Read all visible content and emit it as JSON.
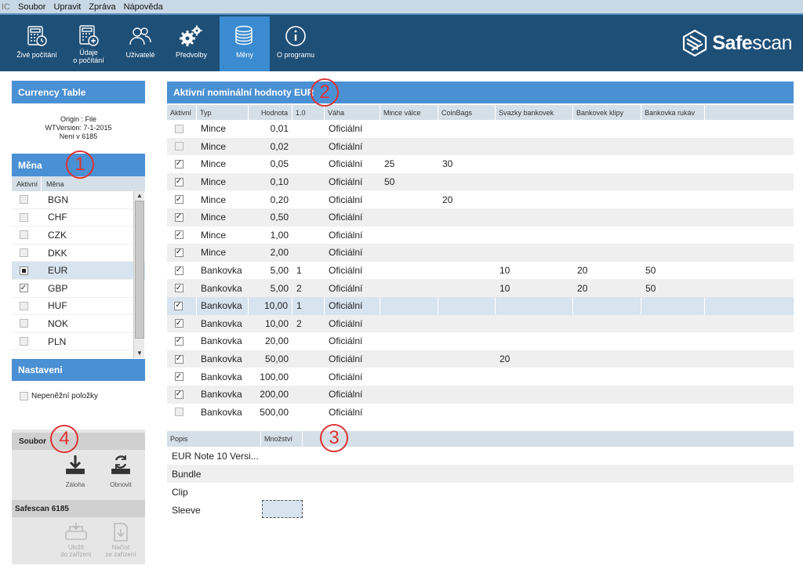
{
  "menubar": {
    "app_fragment": "IC",
    "items": [
      "Soubor",
      "Upravit",
      "Zpráva",
      "Nápověda"
    ]
  },
  "toolbar": {
    "buttons": [
      {
        "label": "Živé počítání",
        "icon": "calculator-clock-icon"
      },
      {
        "label": "Údaje\no počítání",
        "icon": "calculator-plus-icon"
      },
      {
        "label": "Uživatelé",
        "icon": "users-icon"
      },
      {
        "label": "Předvolby",
        "icon": "gears-icon"
      },
      {
        "label": "Měny",
        "icon": "coins-icon",
        "active": true
      },
      {
        "label": "O programu",
        "icon": "info-icon"
      }
    ],
    "logo": {
      "safe": "Safe",
      "scan": "scan"
    }
  },
  "left": {
    "currency_table_title": "Currency Table",
    "origin_lines": [
      "Origin : File",
      "WTVersion: 7-1-2015",
      "Není v 6185"
    ],
    "mena_title": "Měna",
    "mena_columns": [
      "Aktivní",
      "Měna"
    ],
    "currencies": [
      {
        "code": "BGN",
        "state": "off"
      },
      {
        "code": "CHF",
        "state": "off"
      },
      {
        "code": "CZK",
        "state": "off"
      },
      {
        "code": "DKK",
        "state": "off"
      },
      {
        "code": "EUR",
        "state": "partial",
        "selected": true
      },
      {
        "code": "GBP",
        "state": "on"
      },
      {
        "code": "HUF",
        "state": "off"
      },
      {
        "code": "NOK",
        "state": "off"
      },
      {
        "code": "PLN",
        "state": "off"
      }
    ],
    "nastaveni_title": "Nastaveni",
    "non_cash_label": "Nepeněžní položky",
    "soubor_title": "Soubor",
    "zaloha_label": "Záloha",
    "obnovit_label": "Obnovit",
    "device_title": "Safescan 6185",
    "ulozit_label": "Uložit\ndo zařízení",
    "nacist_label": "Načíst\nze zařízení"
  },
  "right": {
    "title": "Aktivní nominální hodnoty EUR",
    "columns": [
      "Aktivní",
      "Typ",
      "Hodnota",
      "1.0",
      "Váha",
      "Mince válce",
      "CoinBags",
      "Svazky bankovek",
      "Bankovek klipy",
      "Bankovka rukáv"
    ],
    "rows": [
      {
        "active": false,
        "type": "Mince",
        "value": "0,01",
        "v10": "",
        "weight": "Oficiální",
        "rolls": "",
        "bags": "",
        "bundles": "",
        "clips": "",
        "sleeves": ""
      },
      {
        "active": false,
        "type": "Mince",
        "value": "0,02",
        "v10": "",
        "weight": "Oficiální",
        "rolls": "",
        "bags": "",
        "bundles": "",
        "clips": "",
        "sleeves": ""
      },
      {
        "active": true,
        "type": "Mince",
        "value": "0,05",
        "v10": "",
        "weight": "Oficiální",
        "rolls": "25",
        "bags": "30",
        "bundles": "",
        "clips": "",
        "sleeves": ""
      },
      {
        "active": true,
        "type": "Mince",
        "value": "0,10",
        "v10": "",
        "weight": "Oficiální",
        "rolls": "50",
        "bags": "",
        "bundles": "",
        "clips": "",
        "sleeves": ""
      },
      {
        "active": true,
        "type": "Mince",
        "value": "0,20",
        "v10": "",
        "weight": "Oficiální",
        "rolls": "",
        "bags": "20",
        "bundles": "",
        "clips": "",
        "sleeves": ""
      },
      {
        "active": true,
        "type": "Mince",
        "value": "0,50",
        "v10": "",
        "weight": "Oficiální",
        "rolls": "",
        "bags": "",
        "bundles": "",
        "clips": "",
        "sleeves": ""
      },
      {
        "active": true,
        "type": "Mince",
        "value": "1,00",
        "v10": "",
        "weight": "Oficiální",
        "rolls": "",
        "bags": "",
        "bundles": "",
        "clips": "",
        "sleeves": ""
      },
      {
        "active": true,
        "type": "Mince",
        "value": "2,00",
        "v10": "",
        "weight": "Oficiální",
        "rolls": "",
        "bags": "",
        "bundles": "",
        "clips": "",
        "sleeves": ""
      },
      {
        "active": true,
        "type": "Bankovka",
        "value": "5,00",
        "v10": "1",
        "weight": "Oficiální",
        "rolls": "",
        "bags": "",
        "bundles": "10",
        "clips": "20",
        "sleeves": "50"
      },
      {
        "active": true,
        "type": "Bankovka",
        "value": "5,00",
        "v10": "2",
        "weight": "Oficiální",
        "rolls": "",
        "bags": "",
        "bundles": "10",
        "clips": "20",
        "sleeves": "50"
      },
      {
        "active": true,
        "type": "Bankovka",
        "value": "10,00",
        "v10": "1",
        "weight": "Oficiální",
        "rolls": "",
        "bags": "",
        "bundles": "",
        "clips": "",
        "sleeves": "",
        "selected": true
      },
      {
        "active": true,
        "type": "Bankovka",
        "value": "10,00",
        "v10": "2",
        "weight": "Oficiální",
        "rolls": "",
        "bags": "",
        "bundles": "",
        "clips": "",
        "sleeves": ""
      },
      {
        "active": true,
        "type": "Bankovka",
        "value": "20,00",
        "v10": "",
        "weight": "Oficiální",
        "rolls": "",
        "bags": "",
        "bundles": "",
        "clips": "",
        "sleeves": ""
      },
      {
        "active": true,
        "type": "Bankovka",
        "value": "50,00",
        "v10": "",
        "weight": "Oficiální",
        "rolls": "",
        "bags": "",
        "bundles": "20",
        "clips": "",
        "sleeves": ""
      },
      {
        "active": true,
        "type": "Bankovka",
        "value": "100,00",
        "v10": "",
        "weight": "Oficiální",
        "rolls": "",
        "bags": "",
        "bundles": "",
        "clips": "",
        "sleeves": ""
      },
      {
        "active": true,
        "type": "Bankovka",
        "value": "200,00",
        "v10": "",
        "weight": "Oficiální",
        "rolls": "",
        "bags": "",
        "bundles": "",
        "clips": "",
        "sleeves": ""
      },
      {
        "active": false,
        "type": "Bankovka",
        "value": "500,00",
        "v10": "",
        "weight": "Oficiální",
        "rolls": "",
        "bags": "",
        "bundles": "",
        "clips": "",
        "sleeves": ""
      }
    ],
    "popis_columns": [
      "Popis",
      "Množství"
    ],
    "popis_rows": [
      {
        "popis": "EUR Note 10 Versi...",
        "qty": ""
      },
      {
        "popis": "Bundle",
        "qty": ""
      },
      {
        "popis": "Clip",
        "qty": ""
      },
      {
        "popis": "Sleeve",
        "qty": ""
      }
    ]
  },
  "annotations": [
    "1",
    "2",
    "3",
    "4"
  ],
  "colors": {
    "header_blue": "#4a90d4",
    "toolbar": "#1e4f77",
    "active_tab": "#3b8bd0",
    "annotation_red": "#d33333"
  }
}
